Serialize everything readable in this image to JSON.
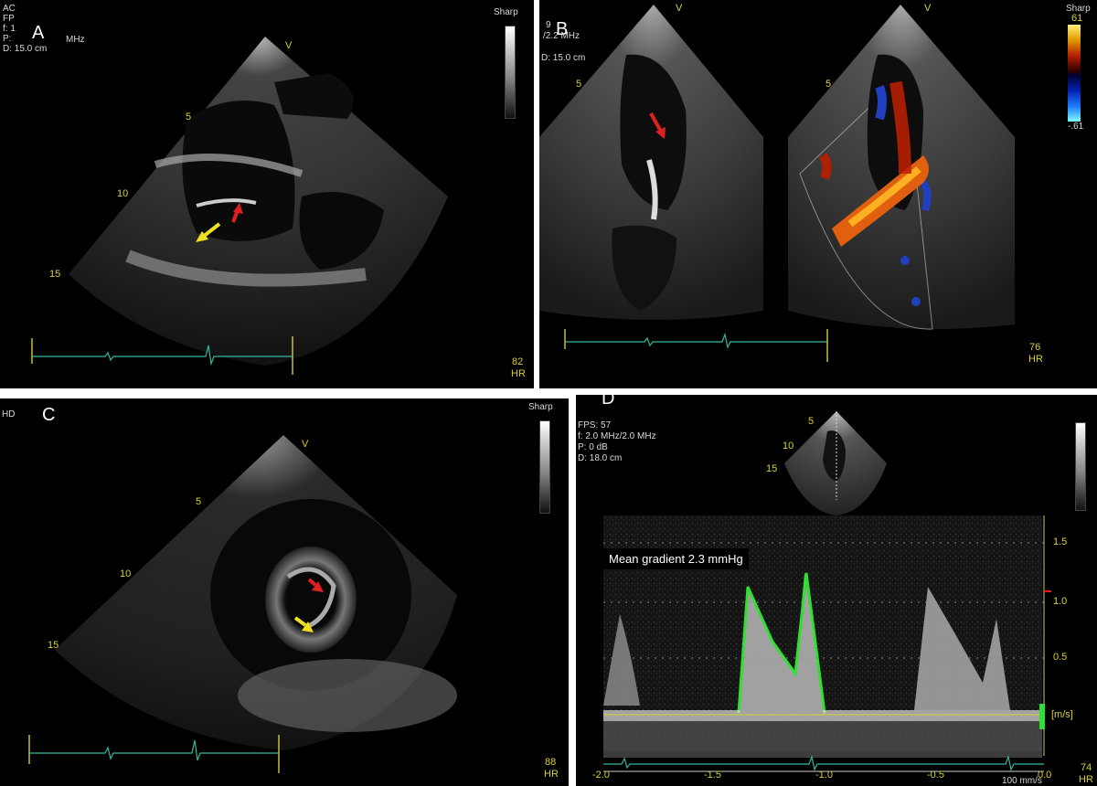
{
  "panels": {
    "a": {
      "letter": "A",
      "header": [
        "AC",
        "FP",
        "f: 1",
        "P: ",
        "D: 15.0 cm"
      ],
      "freq": "MHz",
      "sharp": "Sharp",
      "depth_marks": [
        "5",
        "10",
        "15"
      ],
      "v_mark": "V",
      "hr_value": "82",
      "hr_label": "HR"
    },
    "b": {
      "letter": "B",
      "header": [
        "9",
        "/2.2 MHz"
      ],
      "depth": "D: 15.0 cm",
      "sharp": "Sharp",
      "scale_top": "61",
      "scale_bottom": "-.61",
      "depth_mark": "5",
      "v_mark": "V",
      "hr_value": "76",
      "hr_label": "HR"
    },
    "c": {
      "letter": "C",
      "header": "HD",
      "sharp": "Sharp",
      "depth_marks": [
        "5",
        "10",
        "15"
      ],
      "v_mark": "V",
      "hr_value": "88",
      "hr_label": "HR"
    },
    "d": {
      "letter": "D",
      "header": [
        "FPS: 57",
        "f: 2.0 MHz/2.0 MHz",
        "P: 0 dB",
        "D: 18.0 cm"
      ],
      "depth_marks": [
        "5",
        "10",
        "15"
      ],
      "annotation": "Mean gradient 2.3 mmHg",
      "y_ticks": [
        "1.5",
        "1.0",
        "0.5"
      ],
      "unit": "[m/s]",
      "x_ticks": [
        "-2.0",
        "-1.5",
        "-1.0",
        "-0.5",
        "0.0"
      ],
      "sweep": "100 mm/s",
      "hr_value": "74",
      "hr_label": "HR"
    }
  },
  "colors": {
    "arrow_red": "#e02020",
    "arrow_yellow": "#f0e020",
    "trace_green": "#30e030",
    "ecg": "#2fb8a0"
  }
}
